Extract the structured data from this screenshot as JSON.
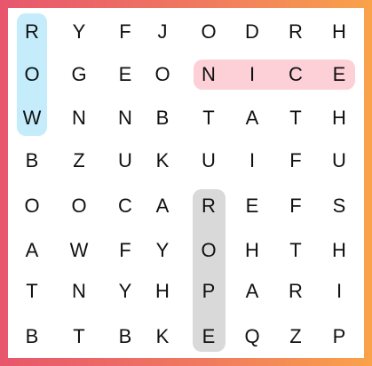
{
  "grid": [
    [
      "R",
      "Y",
      "F",
      "J",
      "O",
      "D",
      "R",
      "H"
    ],
    [
      "O",
      "G",
      "E",
      "O",
      "N",
      "I",
      "C",
      "E"
    ],
    [
      "W",
      "N",
      "N",
      "B",
      "T",
      "A",
      "T",
      "H"
    ],
    [
      "B",
      "Z",
      "U",
      "K",
      "U",
      "I",
      "F",
      "U"
    ],
    [
      "O",
      "O",
      "C",
      "A",
      "R",
      "E",
      "F",
      "S"
    ],
    [
      "A",
      "W",
      "F",
      "Y",
      "O",
      "H",
      "T",
      "H"
    ],
    [
      "T",
      "N",
      "Y",
      "H",
      "P",
      "A",
      "R",
      "I"
    ],
    [
      "B",
      "T",
      "B",
      "K",
      "E",
      "Q",
      "Z",
      "P"
    ]
  ],
  "highlights": [
    {
      "word": "ROW",
      "color": "#c4ecfb",
      "direction": "vertical",
      "start": [
        0,
        0
      ],
      "length": 3
    },
    {
      "word": "NICE",
      "color": "#fcd0d6",
      "direction": "horizontal",
      "start": [
        1,
        4
      ],
      "length": 4
    },
    {
      "word": "ROPE",
      "color": "#d9d9d9",
      "direction": "vertical",
      "start": [
        4,
        4
      ],
      "length": 4
    }
  ],
  "frame_colors": {
    "start": "#e8566d",
    "end": "#f9a24a"
  }
}
